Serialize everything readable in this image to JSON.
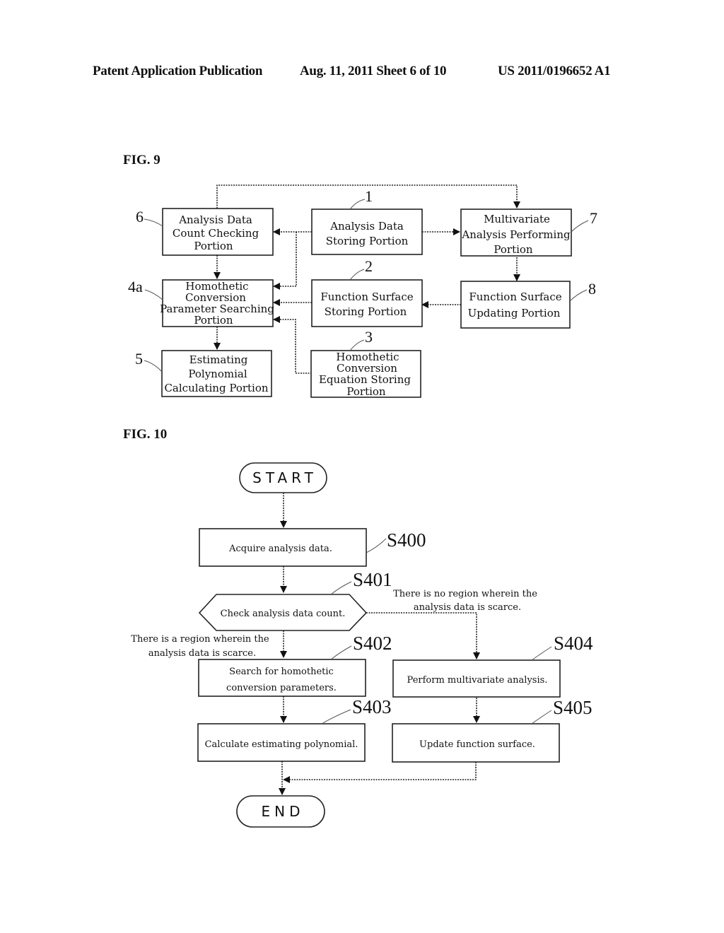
{
  "header": {
    "publication": "Patent Application Publication",
    "date_sheet": "Aug. 11, 2011  Sheet 6 of 10",
    "number": "US 2011/0196652 A1"
  },
  "fig9": {
    "title": "FIG. 9",
    "blocks": [
      {
        "ref": "6",
        "lines": [
          "Analysis Data",
          "Count Checking",
          "Portion"
        ]
      },
      {
        "ref": "1",
        "lines": [
          "Analysis Data",
          "Storing Portion"
        ]
      },
      {
        "ref": "7",
        "lines": [
          "Multivariate",
          "Analysis Performing",
          "Portion"
        ]
      },
      {
        "ref": "4a",
        "lines": [
          "Homothetic",
          "Conversion",
          "Parameter Searching",
          "Portion"
        ]
      },
      {
        "ref": "2",
        "lines": [
          "Function Surface",
          "Storing Portion"
        ]
      },
      {
        "ref": "8",
        "lines": [
          "Function Surface",
          "Updating Portion"
        ]
      },
      {
        "ref": "5",
        "lines": [
          "Estimating",
          "Polynomial",
          "Calculating Portion"
        ]
      },
      {
        "ref": "3",
        "lines": [
          "Homothetic",
          "Conversion",
          "Equation Storing",
          "Portion"
        ]
      }
    ]
  },
  "fig10": {
    "title": "FIG. 10",
    "start": "START",
    "end": "END",
    "steps": [
      {
        "id": "S400",
        "lines": [
          "Acquire analysis data."
        ]
      },
      {
        "id": "S401",
        "lines": [
          "Check analysis data count."
        ]
      },
      {
        "id": "S402",
        "lines": [
          "Search for homothetic",
          "conversion parameters."
        ]
      },
      {
        "id": "S403",
        "lines": [
          "Calculate estimating polynomial."
        ]
      },
      {
        "id": "S404",
        "lines": [
          "Perform multivariate analysis."
        ]
      },
      {
        "id": "S405",
        "lines": [
          "Update function surface."
        ]
      }
    ],
    "branch_yes": [
      "There is a region wherein the",
      "analysis data is scarce."
    ],
    "branch_no": [
      "There is no region wherein the",
      "analysis data is scarce."
    ]
  }
}
